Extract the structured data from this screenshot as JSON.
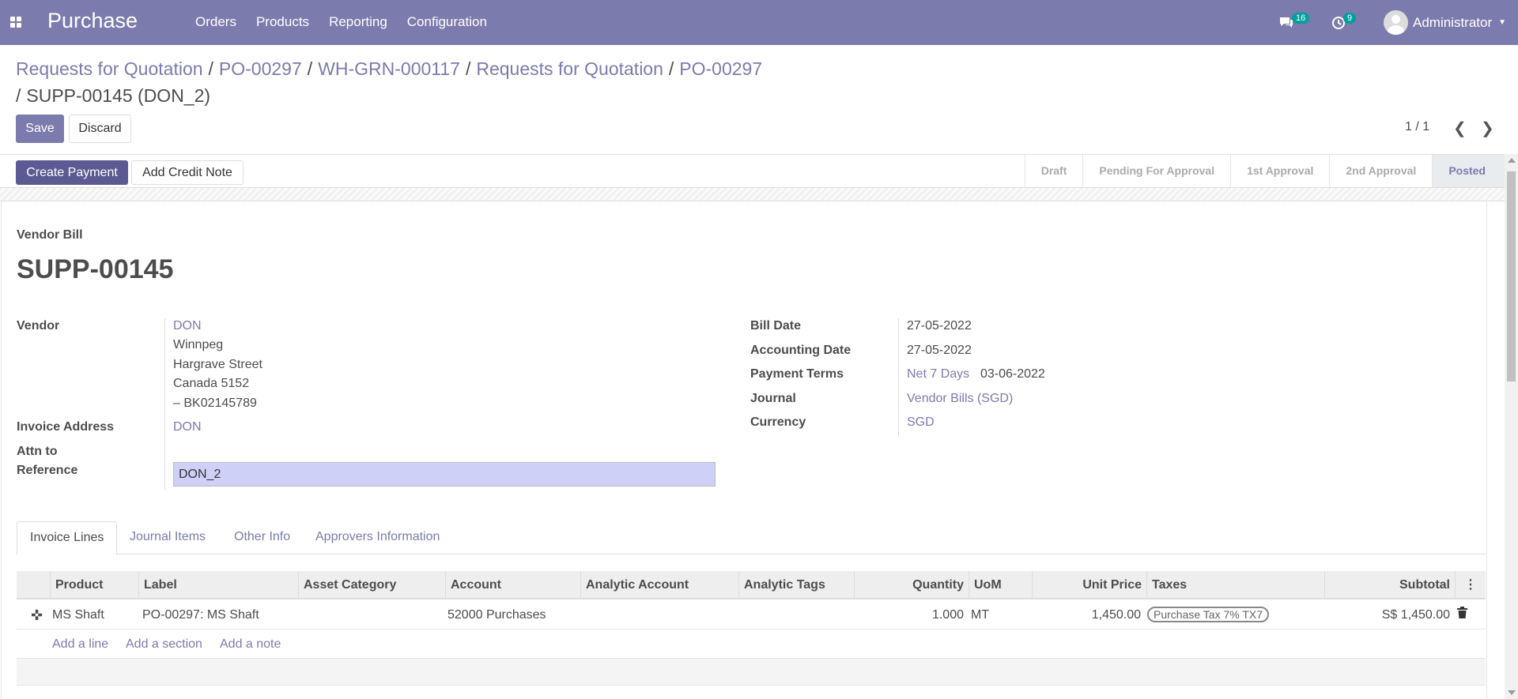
{
  "navbar": {
    "brand": "Purchase",
    "menu": [
      "Orders",
      "Products",
      "Reporting",
      "Configuration"
    ],
    "messages_count": "16",
    "activities_count": "9",
    "user": "Administrator"
  },
  "breadcrumb": {
    "items": [
      "Requests for Quotation",
      "PO-00297",
      "WH-GRN-000117",
      "Requests for Quotation",
      "PO-00297"
    ],
    "current": "SUPP-00145 (DON_2)"
  },
  "controls": {
    "save_label": "Save",
    "discard_label": "Discard",
    "pager": "1 / 1"
  },
  "statusbar": {
    "create_payment_label": "Create Payment",
    "add_credit_note_label": "Add Credit Note",
    "stages": [
      "Draft",
      "Pending For Approval",
      "1st Approval",
      "2nd Approval",
      "Posted"
    ],
    "active_stage": "Posted"
  },
  "document": {
    "type": "Vendor Bill",
    "number": "SUPP-00145"
  },
  "fields_left": {
    "vendor_label": "Vendor",
    "vendor_name": "DON",
    "address": [
      "Winnpeg",
      "Hargrave Street",
      "Canada 5152",
      "– BK02145789"
    ],
    "invoice_address_label": "Invoice Address",
    "invoice_address": "DON",
    "attn_label": "Attn to",
    "reference_label": "Reference",
    "reference_value": "DON_2"
  },
  "fields_right": {
    "bill_date_label": "Bill Date",
    "bill_date": "27-05-2022",
    "accounting_date_label": "Accounting Date",
    "accounting_date": "27-05-2022",
    "payment_terms_label": "Payment Terms",
    "payment_terms": "Net 7 Days",
    "due_date": "03-06-2022",
    "journal_label": "Journal",
    "journal": "Vendor Bills (SGD)",
    "currency_label": "Currency",
    "currency": "SGD"
  },
  "tabs": [
    "Invoice Lines",
    "Journal Items",
    "Other Info",
    "Approvers Information"
  ],
  "table": {
    "headers": [
      "Product",
      "Label",
      "Asset Category",
      "Account",
      "Analytic Account",
      "Analytic Tags",
      "Quantity",
      "UoM",
      "Unit Price",
      "Taxes",
      "Subtotal"
    ],
    "rows": [
      {
        "product": "MS Shaft",
        "label": "PO-00297: MS Shaft",
        "asset_category": "",
        "account": "52000 Purchases",
        "analytic_account": "",
        "analytic_tags": "",
        "quantity": "1.000",
        "uom": "MT",
        "unit_price": "1,450.00",
        "taxes": "Purchase Tax 7% TX7",
        "subtotal": "S$ 1,450.00"
      }
    ],
    "add_line": "Add a line",
    "add_section": "Add a section",
    "add_note": "Add a note"
  },
  "colors": {
    "brand": "#7c7bad",
    "primary_button": "#5b5a93",
    "badge": "#00a09d",
    "reference_input_bg": "#cfd0f7"
  }
}
